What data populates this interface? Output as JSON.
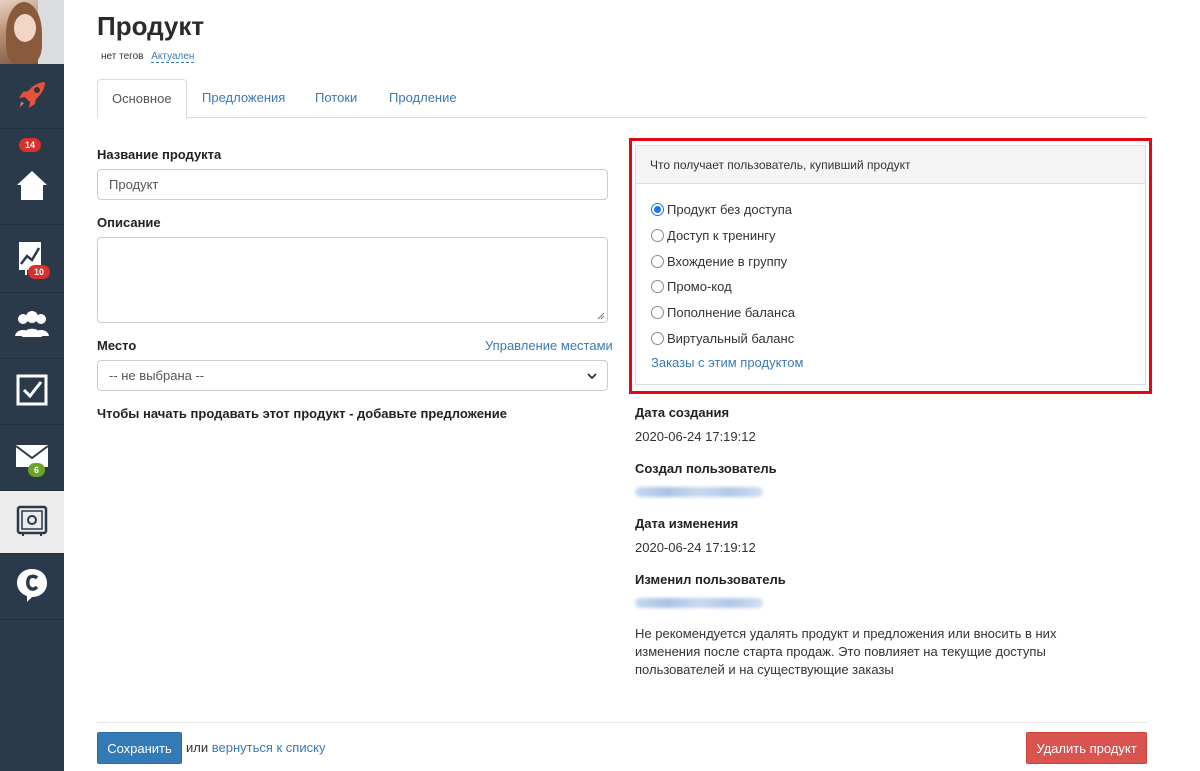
{
  "header": {
    "title": "Продукт",
    "tags_text": "нет тегов",
    "status": "Актуален"
  },
  "sidebar": {
    "items": [
      {
        "icon": "rocket-icon",
        "color": "#e8523a"
      },
      {
        "icon": "home-icon",
        "badge": "14",
        "badge_color": "#d9302c"
      },
      {
        "icon": "chart-icon",
        "badge": "10",
        "badge_color": "#d9302c"
      },
      {
        "icon": "users-icon"
      },
      {
        "icon": "checkbox-icon"
      },
      {
        "icon": "mail-icon",
        "badge": "6",
        "badge_color": "#6aa329"
      },
      {
        "icon": "safe-icon",
        "active": true
      },
      {
        "icon": "chat-logo-icon"
      }
    ]
  },
  "tabs": [
    {
      "label": "Основное",
      "active": true
    },
    {
      "label": "Предложения"
    },
    {
      "label": "Потоки"
    },
    {
      "label": "Продление"
    }
  ],
  "form": {
    "name_label": "Название продукта",
    "name_value": "Продукт",
    "description_label": "Описание",
    "description_value": "",
    "place_label": "Место",
    "manage_places_link": "Управление местами",
    "place_selected": "-- не выбрана --",
    "sell_hint": "Чтобы начать продавать этот продукт - добавьте предложение"
  },
  "panel": {
    "heading": "Что получает пользователь, купивший продукт",
    "options": [
      {
        "label": "Продукт без доступа",
        "checked": true
      },
      {
        "label": "Доступ к тренингу",
        "checked": false
      },
      {
        "label": "Вхождение в группу",
        "checked": false
      },
      {
        "label": "Промо-код",
        "checked": false
      },
      {
        "label": "Пополнение баланса",
        "checked": false
      },
      {
        "label": "Виртуальный баланс",
        "checked": false
      }
    ],
    "orders_link": "Заказы с этим продуктом",
    "highlight_color": "#e30613"
  },
  "meta": {
    "created_label": "Дата создания",
    "created_value": "2020-06-24 17:19:12",
    "created_by_label": "Создал пользователь",
    "modified_label": "Дата изменения",
    "modified_value": "2020-06-24 17:19:12",
    "modified_by_label": "Изменил пользователь",
    "warning": "Не рекомендуется удалять продукт и предложения или вносить в них изменения после старта продаж. Это повлияет на текущие доступы пользователей и на существующие заказы"
  },
  "footer": {
    "save_label": "Сохранить",
    "or_text": "или",
    "back_link": "вернуться к списку",
    "delete_label": "Удалить продукт"
  },
  "colors": {
    "primary": "#337ab7",
    "danger": "#d9534f",
    "link": "#3a7ab8",
    "sidebar": "#2b3a4a"
  }
}
